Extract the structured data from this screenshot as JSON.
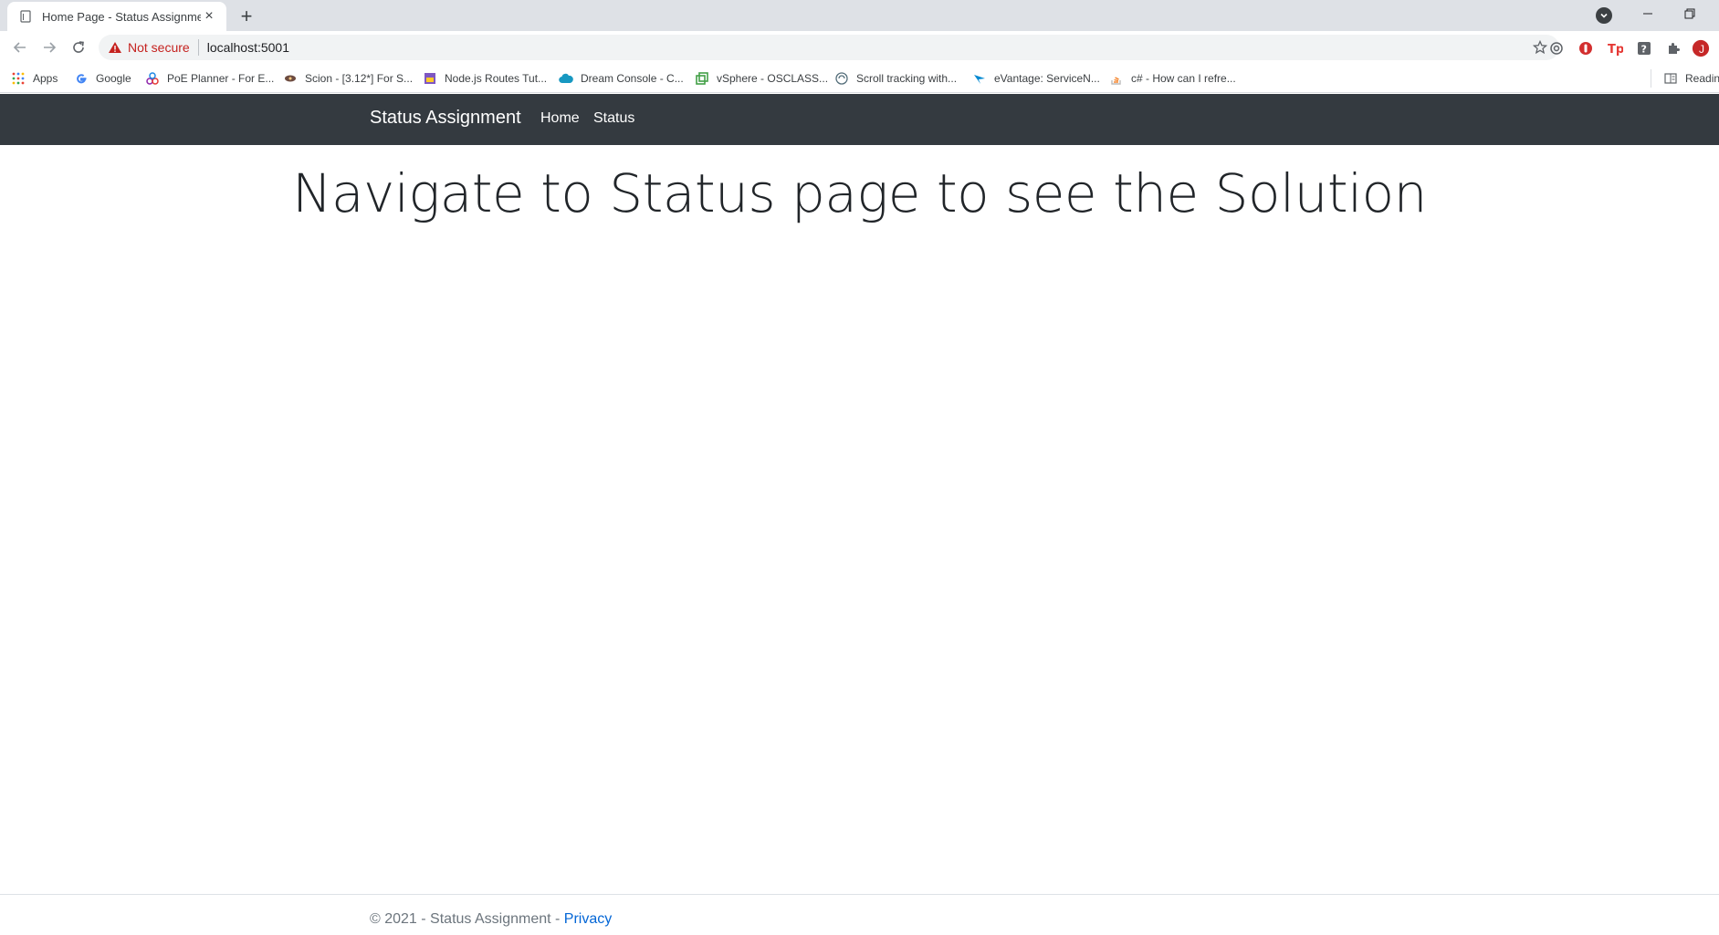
{
  "browser": {
    "tab_title": "Home Page - Status Assignment",
    "new_tab_symbol": "+",
    "close_symbol": "×",
    "security_label": "Not secure",
    "url": "localhost:5001",
    "profile_initial": "J"
  },
  "bookmarks": [
    {
      "label": "Apps",
      "icon": "apps-grid-icon"
    },
    {
      "label": "Google",
      "icon": "google-icon"
    },
    {
      "label": "PoE Planner - For E...",
      "icon": "poe-icon"
    },
    {
      "label": "Scion - [3.12*] For S...",
      "icon": "scion-icon"
    },
    {
      "label": "Node.js Routes Tut...",
      "icon": "node-icon"
    },
    {
      "label": "Dream Console - C...",
      "icon": "salesforce-cloud-icon"
    },
    {
      "label": "vSphere - OSCLASS...",
      "icon": "vsphere-icon"
    },
    {
      "label": "Scroll tracking with...",
      "icon": "scroll-icon"
    },
    {
      "label": "eVantage: ServiceN...",
      "icon": "evantage-icon"
    },
    {
      "label": "c# - How can I refre...",
      "icon": "stackoverflow-icon"
    }
  ],
  "reading_list_label": "Reading",
  "site": {
    "brand": "Status Assignment",
    "nav": [
      {
        "label": "Home"
      },
      {
        "label": "Status"
      }
    ],
    "heading": "Navigate to Status page to see the Solution",
    "footer_prefix": "© 2021 - Status Assignment - ",
    "footer_link": "Privacy"
  },
  "colors": {
    "navbar_bg": "#343a40",
    "link": "#0366d6",
    "not_secure": "#c5221f"
  }
}
